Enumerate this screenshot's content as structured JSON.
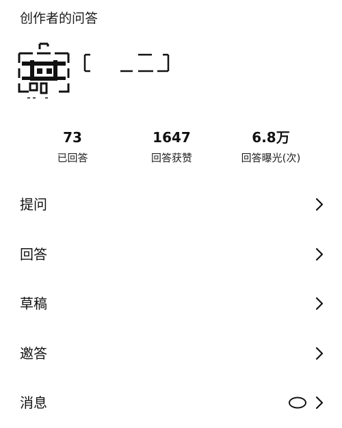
{
  "header": {
    "title": "创作者的问答"
  },
  "profile": {
    "avatar_icon": "avatar-redacted",
    "name": ""
  },
  "stats": [
    {
      "value": "73",
      "label": "已回答"
    },
    {
      "value": "1647",
      "label": "回答获赞"
    },
    {
      "value": "6.8万",
      "label": "回答曝光(次)"
    }
  ],
  "menu": {
    "items": [
      {
        "label": "提问",
        "icon": "chevron-right-icon"
      },
      {
        "label": "回答",
        "icon": "chevron-right-icon"
      },
      {
        "label": "草稿",
        "icon": "chevron-right-icon"
      },
      {
        "label": "邀答",
        "icon": "chevron-right-icon"
      },
      {
        "label": "消息",
        "icon": "chevron-right-icon",
        "badge": "unread-dot"
      }
    ]
  },
  "colors": {
    "text": "#111111",
    "background": "#ffffff"
  }
}
